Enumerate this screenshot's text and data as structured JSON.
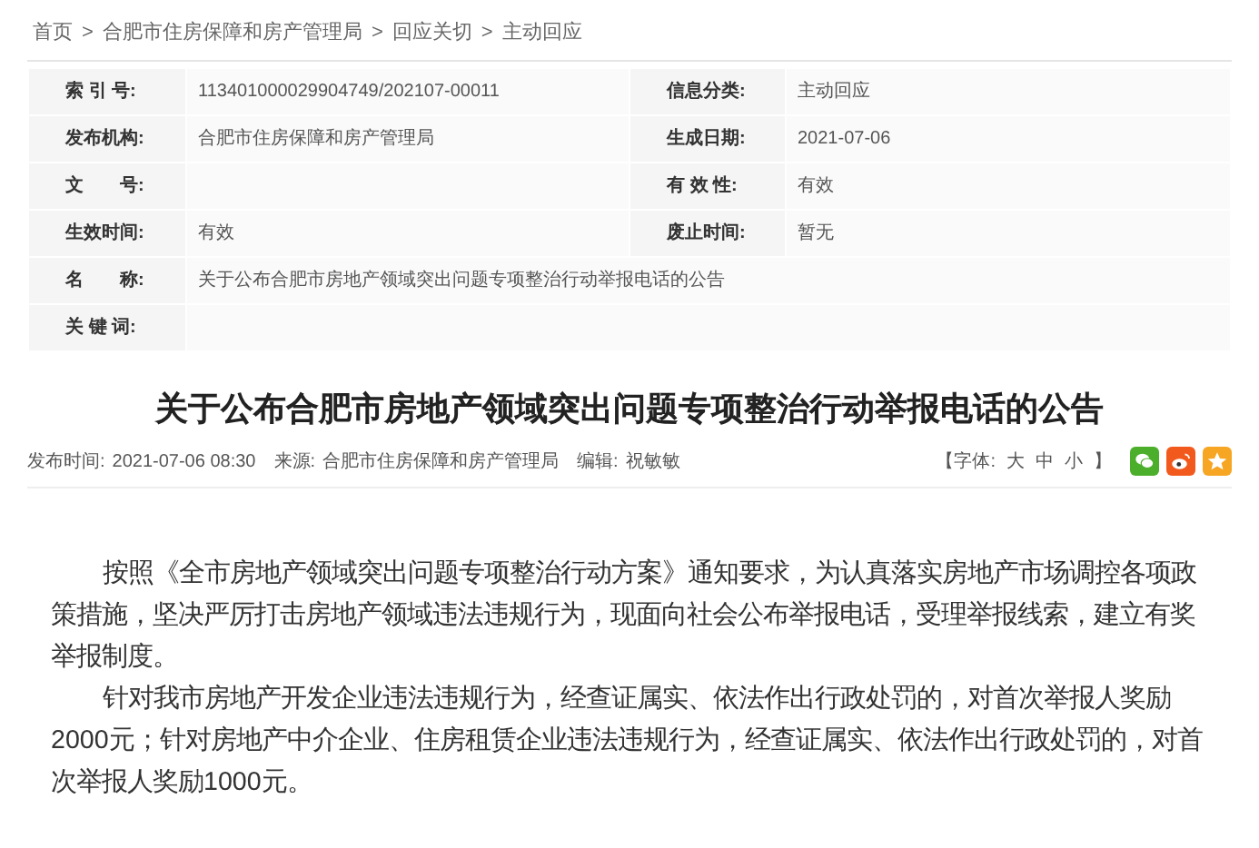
{
  "breadcrumb": [
    "首页",
    "合肥市住房保障和房产管理局",
    "回应关切",
    "主动回应"
  ],
  "breadcrumb_separator": ">",
  "info_table": [
    [
      {
        "label": "索 引 号:",
        "value": "113401000029904749/202107-00011"
      },
      {
        "label": "信息分类:",
        "value": "主动回应"
      }
    ],
    [
      {
        "label": "发布机构:",
        "value": "合肥市住房保障和房产管理局"
      },
      {
        "label": "生成日期:",
        "value": "2021-07-06"
      }
    ],
    [
      {
        "label": "文　　号:"
      },
      {
        "label": "有 效 性:",
        "value": "有效"
      }
    ],
    [
      {
        "label": "生效时间:",
        "value": "有效"
      },
      {
        "label": "废止时间:",
        "value": "暂无"
      }
    ],
    [
      {
        "label": "名　　称:",
        "value": "关于公布合肥市房地产领域突出问题专项整治行动举报电话的公告"
      }
    ],
    [
      {
        "label": "关 键 词:"
      }
    ]
  ],
  "article_title": "关于公布合肥市房地产领域突出问题专项整治行动举报电话的公告",
  "meta": {
    "published_label": "发布时间:",
    "published": "2021-07-06 08:30",
    "source_label": "来源:",
    "source": "合肥市住房保障和房产管理局",
    "editor_label": "编辑:",
    "editor": "祝敏敏"
  },
  "font_size": {
    "open": "【字体:",
    "options": [
      "大",
      "中",
      "小"
    ],
    "close": "】"
  },
  "share_buttons": [
    {
      "kind": "wechat",
      "color": "#4caf2b"
    },
    {
      "kind": "weibo",
      "color": "#f25a1d"
    },
    {
      "kind": "favorite",
      "color": "#f6a623"
    }
  ],
  "paragraphs": [
    "按照《全市房地产领域突出问题专项整治行动方案》通知要求，为认真落实房地产市场调控各项政策措施，坚决严厉打击房地产领域违法违规行为，现面向社会公布举报电话，受理举报线索，建立有奖举报制度。",
    "针对我市房地产开发企业违法违规行为，经查证属实、依法作出行政处罚的，对首次举报人奖励2000元；针对房地产中介企业、住房租赁企业违法违规行为，经查证属实、依法作出行政处罚的，对首次举报人奖励1000元。"
  ]
}
